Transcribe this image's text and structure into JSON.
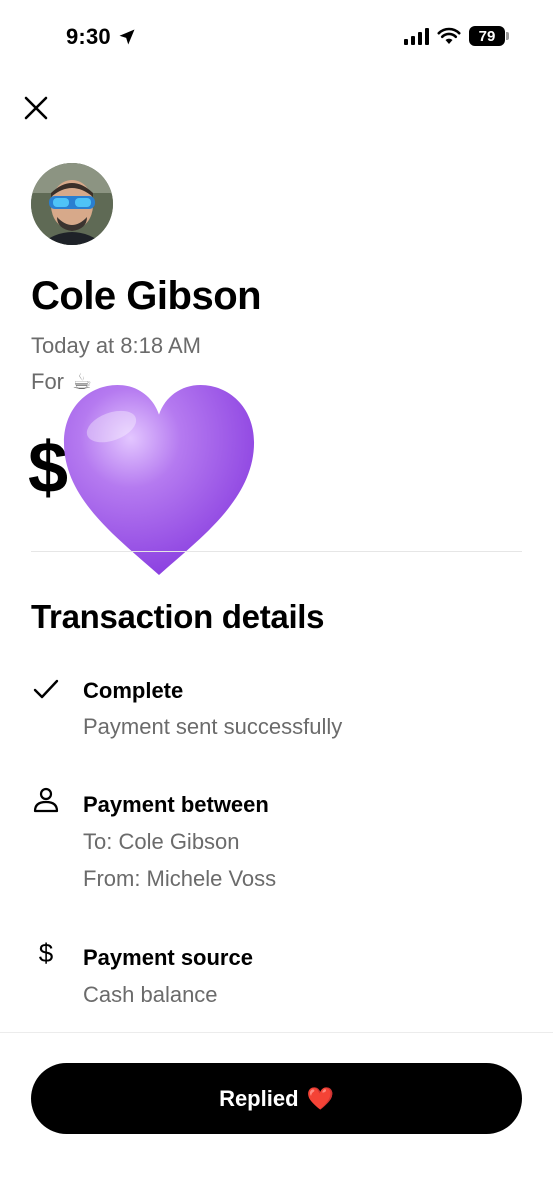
{
  "status_bar": {
    "time": "9:30",
    "battery": "79"
  },
  "header": {
    "close_icon": "close-icon"
  },
  "payment": {
    "name": "Cole Gibson",
    "date": "Today at 8:18 AM",
    "for_label": "For",
    "for_emoji": "☕",
    "amount_symbol": "$",
    "amount_obscured_by": "purple-heart"
  },
  "details": {
    "title": "Transaction details",
    "items": [
      {
        "icon": "check-icon",
        "title": "Complete",
        "lines": [
          "Payment sent successfully"
        ]
      },
      {
        "icon": "person-icon",
        "title": "Payment between",
        "lines": [
          "To: Cole Gibson",
          "From: Michele Voss"
        ]
      },
      {
        "icon": "dollar-icon",
        "title": "Payment source",
        "lines": [
          "Cash balance"
        ]
      }
    ]
  },
  "action": {
    "button_label": "Replied",
    "button_emoji": "❤️"
  },
  "colors": {
    "accent": "#000000",
    "secondary_text": "#6b6b6b",
    "heart": "#9b4de8"
  }
}
